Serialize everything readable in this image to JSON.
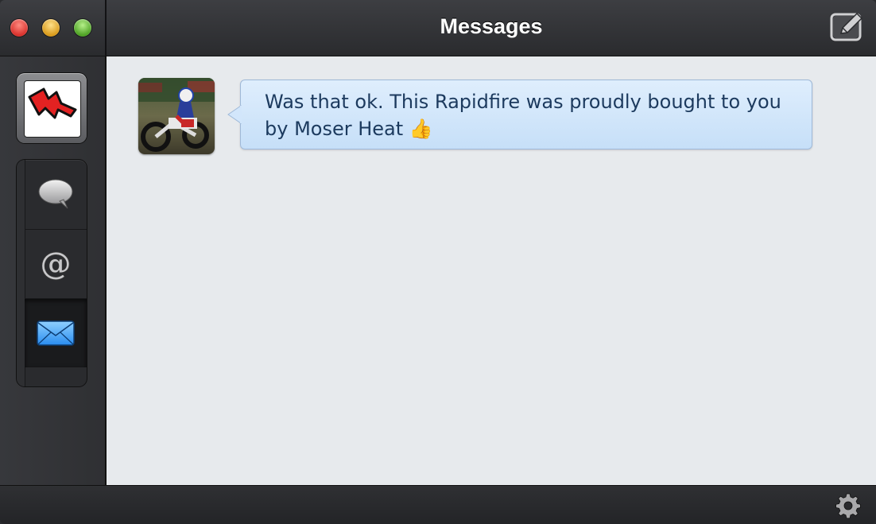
{
  "window": {
    "title": "Messages"
  },
  "sidebar": {
    "account": {
      "icon": "rapidfire-logo-icon"
    },
    "nav": [
      {
        "icon": "speech-bubble-icon",
        "name": "timeline"
      },
      {
        "icon": "at-sign-icon",
        "name": "mentions"
      },
      {
        "icon": "envelope-icon",
        "name": "messages",
        "selected": true
      }
    ]
  },
  "conversation": {
    "messages": [
      {
        "avatar": "motocross-photo",
        "text": "Was that ok. This Rapidfire was proudly bought to you by Moser Heat 👍"
      }
    ]
  },
  "bottombar": {
    "settings_icon": "gear-icon"
  },
  "colors": {
    "accent_blue": "#3aa0ff",
    "bubble": "#d3e6fb",
    "content_bg": "#e7eaed"
  }
}
